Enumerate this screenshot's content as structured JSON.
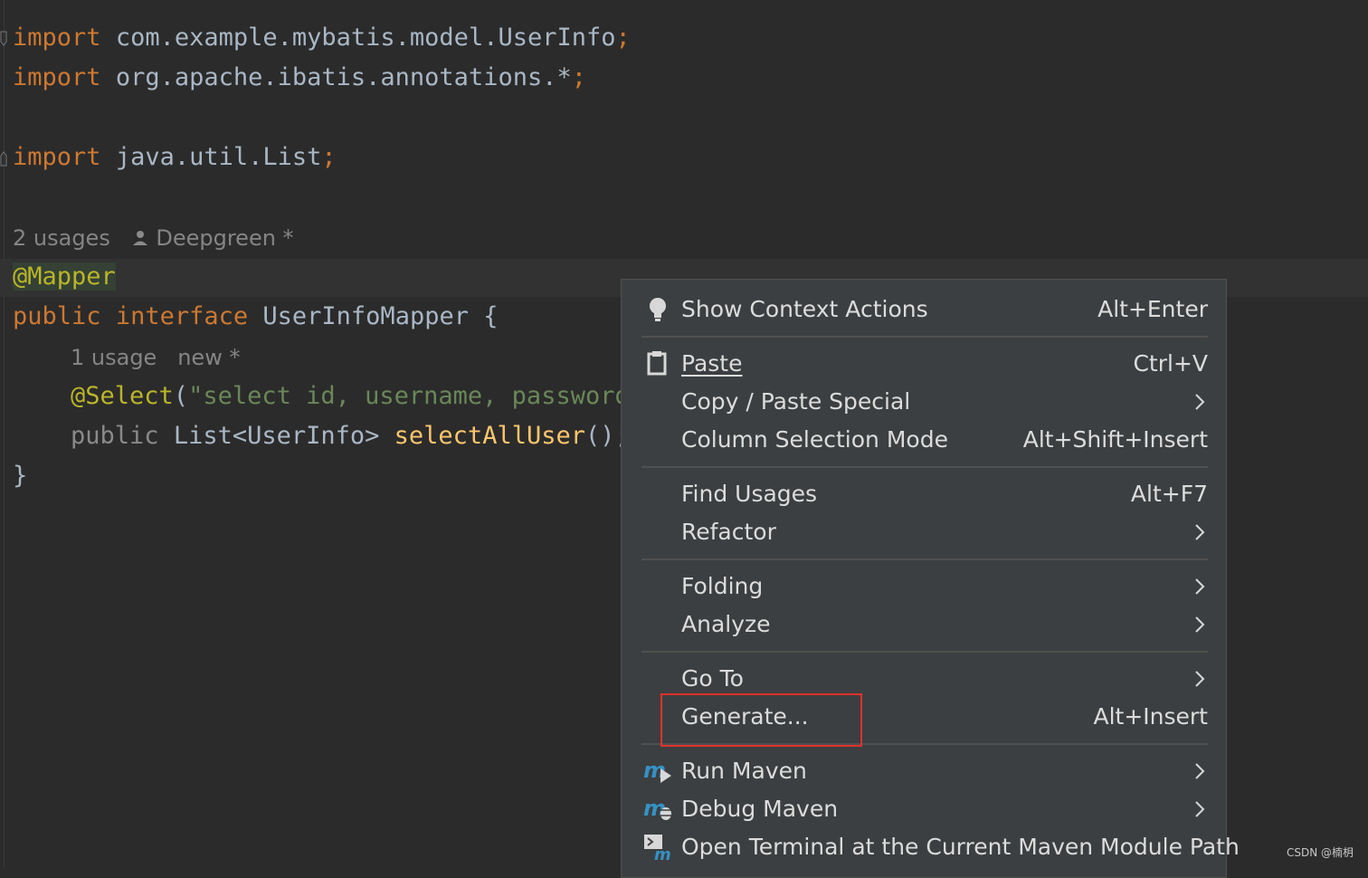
{
  "code": {
    "imports": [
      {
        "keyword": "import",
        "path": "com.example.mybatis.model.UserInfo",
        "end": ";"
      },
      {
        "keyword": "import",
        "path": "org.apache.ibatis.annotations.*",
        "end": ";"
      },
      {
        "keyword": "import",
        "path": "java.util.List",
        "end": ";"
      }
    ],
    "class_hint": {
      "usages": "2 usages",
      "author": "Deepgreen *"
    },
    "annotation": "@Mapper",
    "class_decl": {
      "kw1": "public",
      "kw2": "interface",
      "name": "UserInfoMapper",
      "brace": "{"
    },
    "method_hint": {
      "usages": "1 usage",
      "author": "new *"
    },
    "select": {
      "annotation": "@Select",
      "paren": "(",
      "string": "\"select id, username, password"
    },
    "method_decl": {
      "kw": "public",
      "type": "List<UserInfo>",
      "name": "selectAllUser",
      "end": "();"
    },
    "close_brace": "}"
  },
  "context_menu": {
    "items": [
      {
        "label": "Show Context Actions",
        "shortcut": "Alt+Enter",
        "icon": "lightbulb-icon"
      },
      {
        "label": "Paste",
        "shortcut": "Ctrl+V",
        "icon": "clipboard-icon"
      },
      {
        "label": "Copy / Paste Special",
        "submenu": true
      },
      {
        "label": "Column Selection Mode",
        "shortcut": "Alt+Shift+Insert"
      },
      {
        "label": "Find Usages",
        "shortcut": "Alt+F7"
      },
      {
        "label": "Refactor",
        "submenu": true
      },
      {
        "label": "Folding",
        "submenu": true
      },
      {
        "label": "Analyze",
        "submenu": true
      },
      {
        "label": "Go To",
        "submenu": true
      },
      {
        "label": "Generate...",
        "shortcut": "Alt+Insert"
      },
      {
        "label": "Run Maven",
        "submenu": true,
        "icon": "maven-run-icon"
      },
      {
        "label": "Debug Maven",
        "submenu": true,
        "icon": "maven-debug-icon"
      },
      {
        "label": "Open Terminal at the Current Maven Module Path",
        "icon": "maven-terminal-icon"
      }
    ]
  },
  "watermark": "CSDN @楠枂",
  "colors": {
    "editor_bg": "#2b2b2b",
    "menu_bg": "#3c3f41",
    "keyword": "#cc7832",
    "annotation": "#bbb529",
    "string": "#6a8759",
    "function": "#ffc66d",
    "highlight_box": "#e0312a",
    "maven_blue": "#3592c4"
  }
}
